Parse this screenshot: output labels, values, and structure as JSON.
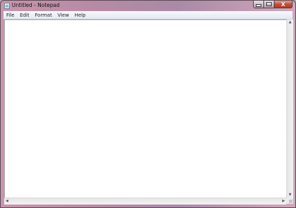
{
  "window": {
    "title": "Untitled - Notepad",
    "icon": "notepad-icon"
  },
  "caption_buttons": {
    "minimize_icon": "minimize-icon",
    "maximize_icon": "maximize-icon",
    "close_label": "X"
  },
  "menubar": {
    "items": [
      "File",
      "Edit",
      "Format",
      "View",
      "Help"
    ]
  },
  "editor": {
    "text": ""
  },
  "scrollbars": {
    "up_arrow": "▲",
    "down_arrow": "▼",
    "left_arrow": "◀",
    "right_arrow": "▶"
  },
  "colors": {
    "title_bar": "#b88aa4",
    "close_button": "#c44a32",
    "editor_background": "#ffffff"
  }
}
